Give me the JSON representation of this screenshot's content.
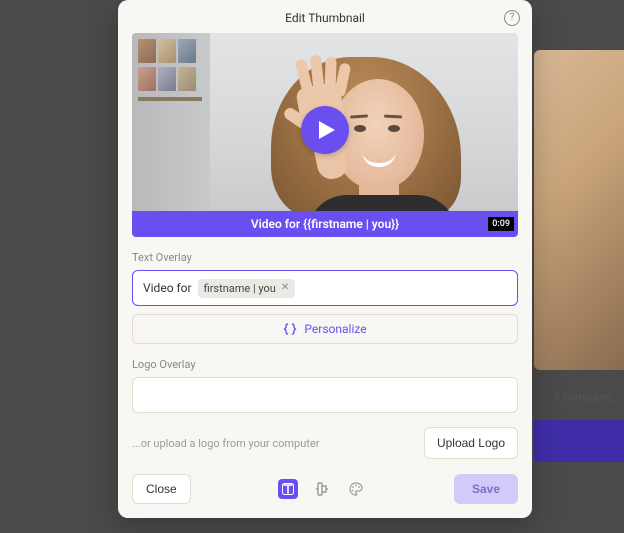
{
  "modal": {
    "title": "Edit Thumbnail",
    "video": {
      "overlay_text": "Video for {{firstname | you}}",
      "duration": "0:09"
    },
    "text_overlay": {
      "label": "Text Overlay",
      "prefix": "Video for",
      "token": "firstname | you",
      "personalize_label": "Personalize"
    },
    "logo_overlay": {
      "label": "Logo Overlay",
      "hint": "...or upload a logo from your computer",
      "upload_label": "Upload Logo"
    },
    "footer": {
      "close": "Close",
      "save": "Save"
    }
  },
  "background": {
    "text_hint": "r company..."
  }
}
